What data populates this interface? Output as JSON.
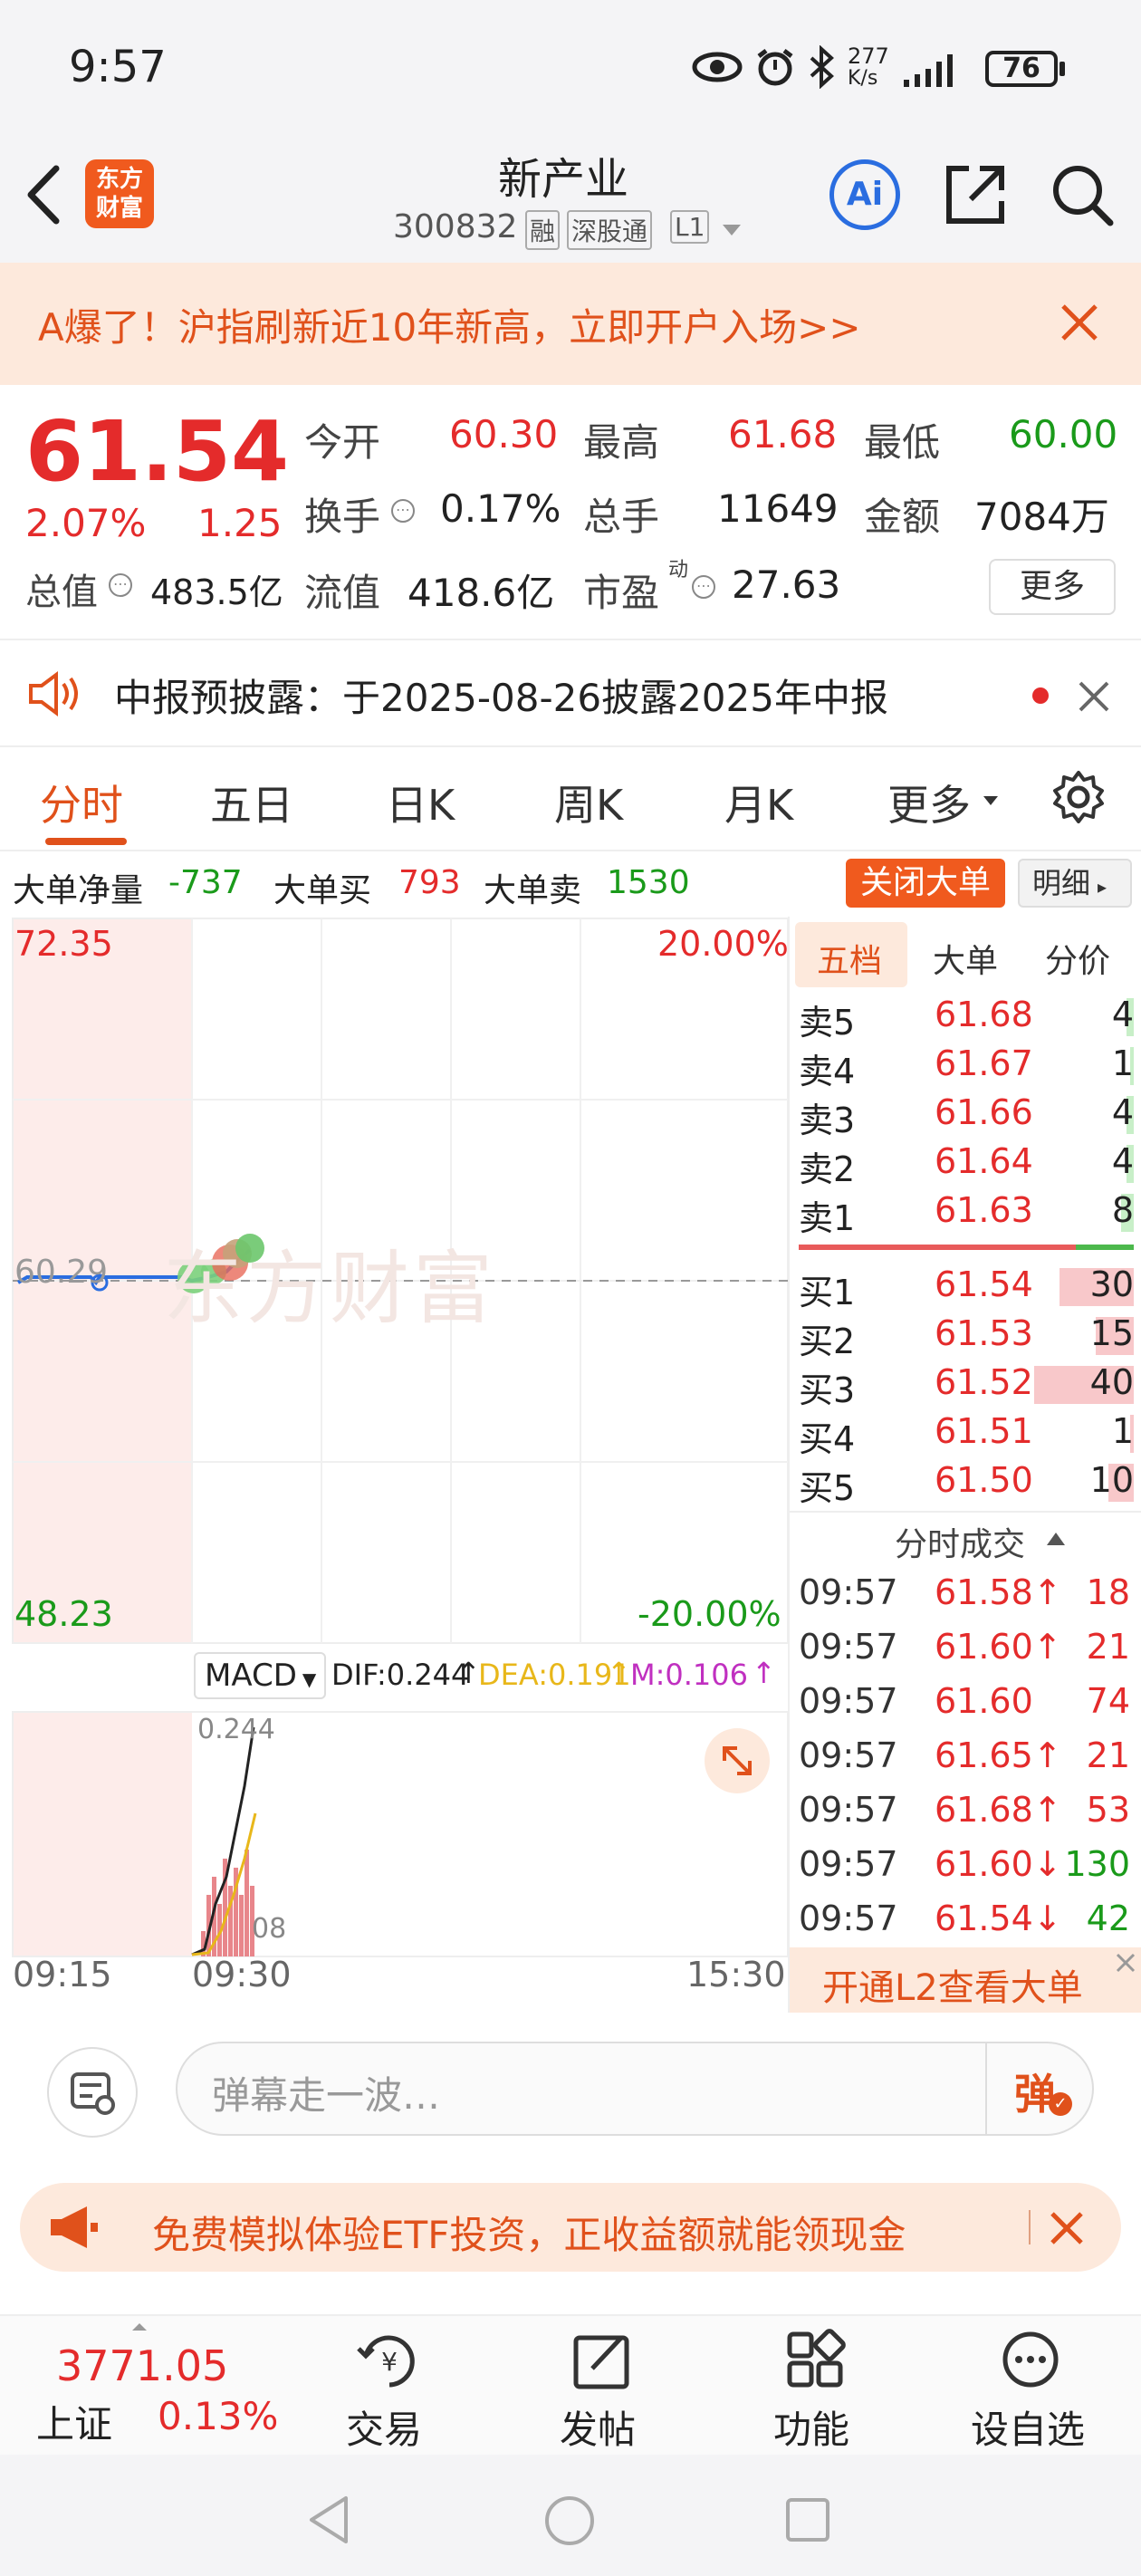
{
  "status": {
    "time": "9:57",
    "net_speed_top": "277",
    "net_speed_bottom": "K/s",
    "battery": "76"
  },
  "nav": {
    "logo_line1": "东方",
    "logo_line2": "财富",
    "title": "新产业",
    "code": "300832",
    "tag1": "融",
    "tag2": "深股通",
    "tag3": "L1",
    "ai": "Ai"
  },
  "banner": {
    "text": "A爆了！沪指刷新近10年新高，立即开户入场>>"
  },
  "quote": {
    "price": "61.54",
    "change_pct": "2.07%",
    "change": "1.25",
    "open_label": "今开",
    "open": "60.30",
    "high_label": "最高",
    "high": "61.68",
    "low_label": "最低",
    "low": "60.00",
    "turnover_label": "换手",
    "turnover": "0.17%",
    "volume_label": "总手",
    "volume": "11649",
    "amount_label": "金额",
    "amount": "7084万",
    "mktcap_label": "总值",
    "mktcap": "483.5亿",
    "float_label": "流值",
    "float": "418.6亿",
    "pe_label": "市盈",
    "pe_sup": "动",
    "pe": "27.63",
    "more": "更多"
  },
  "notice": {
    "text": "中报预披露：于2025-08-26披露2025年中报"
  },
  "tabs": [
    "分时",
    "五日",
    "日K",
    "周K",
    "月K",
    "更多"
  ],
  "bigorder": {
    "net_label": "大单净量",
    "net": "-737",
    "buy_label": "大单买",
    "buy": "793",
    "sell_label": "大单卖",
    "sell": "1530",
    "close_btn": "关闭大单",
    "detail_btn": "明细"
  },
  "chart": {
    "ymax": "72.35",
    "ymin": "48.23",
    "pmax": "20.00%",
    "pmin": "-20.00%",
    "mid": "60.29",
    "watermark": "东方财富",
    "macd_label": "MACD",
    "dif": "DIF:0.244",
    "dea": "DEA:0.191",
    "m": "M:0.106",
    "macd_top": "0.244",
    "macd_bottom": "08",
    "t_start": "09:15",
    "t_mid": "09:30",
    "t_end": "15:30"
  },
  "book": {
    "tabs": [
      "五档",
      "大单",
      "分价"
    ],
    "asks": [
      {
        "label": "卖5",
        "price": "61.68",
        "vol": "4"
      },
      {
        "label": "卖4",
        "price": "61.67",
        "vol": "1"
      },
      {
        "label": "卖3",
        "price": "61.66",
        "vol": "4"
      },
      {
        "label": "卖2",
        "price": "61.64",
        "vol": "4"
      },
      {
        "label": "卖1",
        "price": "61.63",
        "vol": "8"
      }
    ],
    "bids": [
      {
        "label": "买1",
        "price": "61.54",
        "vol": "30"
      },
      {
        "label": "买2",
        "price": "61.53",
        "vol": "15"
      },
      {
        "label": "买3",
        "price": "61.52",
        "vol": "40"
      },
      {
        "label": "买4",
        "price": "61.51",
        "vol": "1"
      },
      {
        "label": "买5",
        "price": "61.50",
        "vol": "10"
      }
    ],
    "ticks_title": "分时成交",
    "ticks": [
      {
        "time": "09:57",
        "price": "61.58↑",
        "vol": "18"
      },
      {
        "time": "09:57",
        "price": "61.60↑",
        "vol": "21"
      },
      {
        "time": "09:57",
        "price": "61.60",
        "vol": "74"
      },
      {
        "time": "09:57",
        "price": "61.65↑",
        "vol": "21"
      },
      {
        "time": "09:57",
        "price": "61.68↑",
        "vol": "53"
      },
      {
        "time": "09:57",
        "price": "61.60↓",
        "vol": "130"
      },
      {
        "time": "09:57",
        "price": "61.54↓",
        "vol": "42"
      }
    ],
    "l2": "开通L2查看大单"
  },
  "danmu": {
    "placeholder": "弹幕走一波…",
    "send": "弹"
  },
  "promo": {
    "text": "免费模拟体验ETF投资，正收益额就能领现金"
  },
  "bottom": {
    "index_value": "3771.05",
    "index_name": "上证",
    "index_change": "0.13%",
    "items": [
      "交易",
      "发帖",
      "功能",
      "设自选"
    ]
  }
}
